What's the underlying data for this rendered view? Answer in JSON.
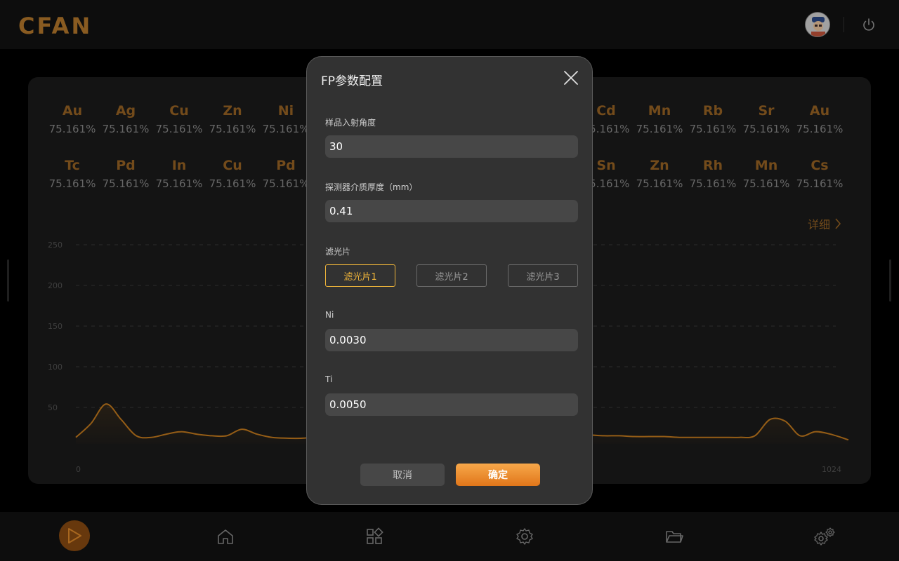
{
  "header": {
    "logo_text": "CFAN",
    "avatar_icon": "user-avatar",
    "power_icon": "power-icon"
  },
  "elements": {
    "row1": [
      {
        "symbol": "Au",
        "value": "75.161%"
      },
      {
        "symbol": "Ag",
        "value": "75.161%"
      },
      {
        "symbol": "Cu",
        "value": "75.161%"
      },
      {
        "symbol": "Zn",
        "value": "75.161%"
      },
      {
        "symbol": "Ni",
        "value": "75.161%"
      },
      {
        "symbol": "Cd",
        "value": "75.161%"
      },
      {
        "symbol": "Mn",
        "value": "75.161%"
      },
      {
        "symbol": "Rb",
        "value": "75.161%"
      },
      {
        "symbol": "Sr",
        "value": "75.161%"
      },
      {
        "symbol": "Au",
        "value": "75.161%"
      }
    ],
    "row2": [
      {
        "symbol": "Tc",
        "value": "75.161%"
      },
      {
        "symbol": "Pd",
        "value": "75.161%"
      },
      {
        "symbol": "In",
        "value": "75.161%"
      },
      {
        "symbol": "Cu",
        "value": "75.161%"
      },
      {
        "symbol": "Pd",
        "value": "75.161%"
      },
      {
        "symbol": "Sn",
        "value": "75.161%"
      },
      {
        "symbol": "Zn",
        "value": "75.161%"
      },
      {
        "symbol": "Rh",
        "value": "75.161%"
      },
      {
        "symbol": "Mn",
        "value": "75.161%"
      },
      {
        "symbol": "Cs",
        "value": "75.161%"
      }
    ],
    "detail_label": "详细"
  },
  "chart_data": {
    "type": "area",
    "x_tick_labels": [
      "0",
      "1024"
    ],
    "y_tick_labels": [
      "50",
      "100",
      "150",
      "200",
      "250"
    ],
    "xlim": [
      0,
      1024
    ],
    "ylim": [
      0,
      250
    ],
    "grid": true,
    "line_color": "#c77c1e",
    "x": [
      0,
      20,
      40,
      60,
      80,
      100,
      120,
      140,
      160,
      180,
      200,
      220,
      240,
      260,
      280,
      300,
      320,
      330,
      340,
      360,
      380,
      400,
      420,
      440,
      460,
      480,
      500,
      520,
      540,
      560,
      580,
      600,
      620,
      640,
      660,
      680,
      700,
      720,
      740,
      760,
      780,
      800,
      820,
      840,
      860,
      880,
      900,
      920,
      940,
      960,
      980,
      1000,
      1024
    ],
    "y": [
      8,
      25,
      49,
      30,
      10,
      8,
      12,
      15,
      12,
      10,
      10,
      18,
      12,
      8,
      7,
      7,
      9,
      14,
      115,
      225,
      160,
      100,
      60,
      40,
      30,
      25,
      22,
      20,
      18,
      17,
      16,
      14,
      13,
      12,
      11,
      11,
      10,
      10,
      9,
      9,
      9,
      8,
      8,
      8,
      8,
      8,
      10,
      30,
      28,
      10,
      15,
      12,
      5
    ]
  },
  "modal": {
    "title": "FP参数配置",
    "close_icon": "close-icon",
    "fields": {
      "angle_label": "样品入射角度",
      "angle_value": "30",
      "thickness_label": "探测器介质厚度（mm）",
      "thickness_value": "0.41",
      "filter_label": "滤光片",
      "filters": [
        "滤光片1",
        "滤光片2",
        "滤光片3"
      ],
      "active_filter": 0,
      "ni_label": "Ni",
      "ni_value": "0.0030",
      "ti_label": "Ti",
      "ti_value": "0.0050"
    },
    "cancel_label": "取消",
    "confirm_label": "确定"
  },
  "colors": {
    "accent": "#f0b53a",
    "brand": "#b77a2c",
    "confirm": "#e8871f"
  },
  "bottombar_icons": [
    "play-icon",
    "home-icon",
    "apps-icon",
    "settings-icon",
    "folder-icon",
    "advanced-settings-icon"
  ]
}
